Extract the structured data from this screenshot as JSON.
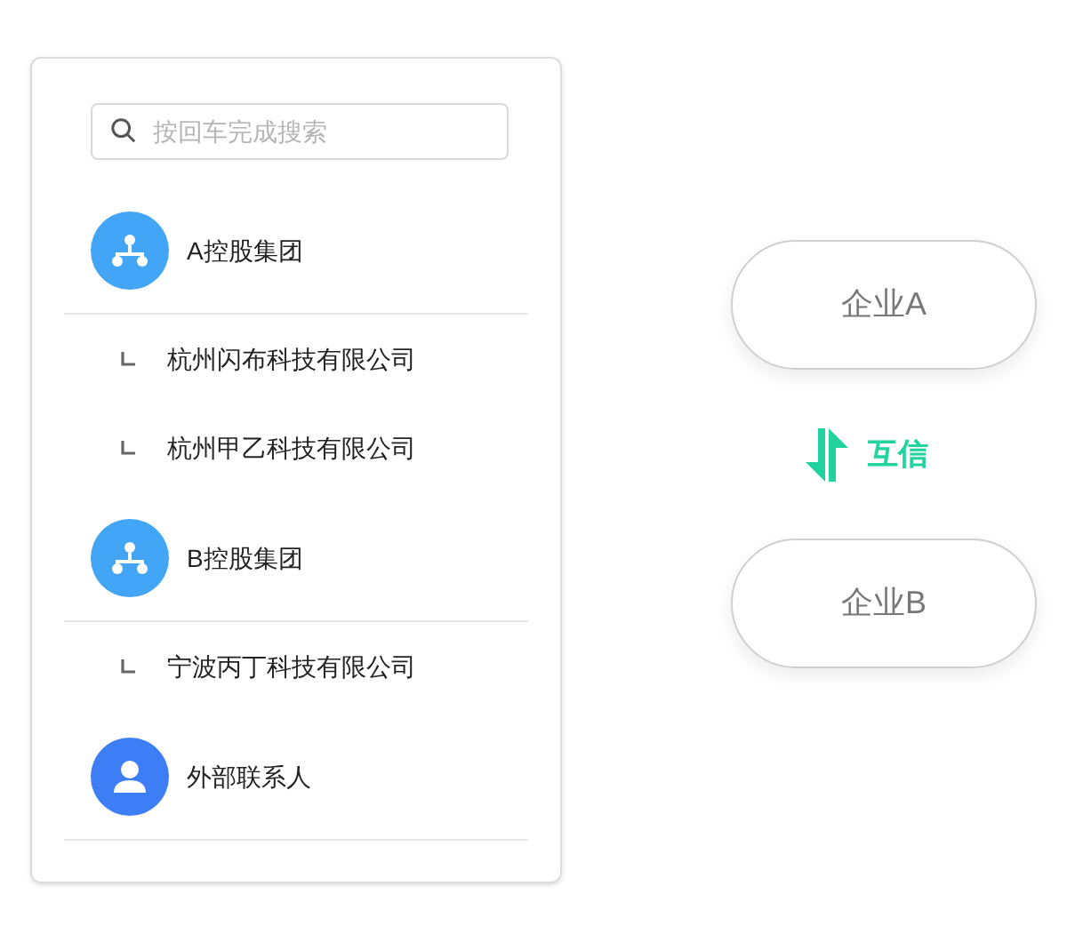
{
  "search": {
    "placeholder": "按回车完成搜索"
  },
  "tree": [
    {
      "kind": "org",
      "label": "A控股集团",
      "children": [
        {
          "label": "杭州闪布科技有限公司"
        },
        {
          "label": "杭州甲乙科技有限公司"
        }
      ]
    },
    {
      "kind": "org",
      "label": "B控股集团",
      "children": [
        {
          "label": "宁波丙丁科技有限公司"
        }
      ]
    },
    {
      "kind": "contact",
      "label": "外部联系人"
    }
  ],
  "enterprises": [
    "企业A",
    "企业B"
  ],
  "link": {
    "label": "互信"
  }
}
